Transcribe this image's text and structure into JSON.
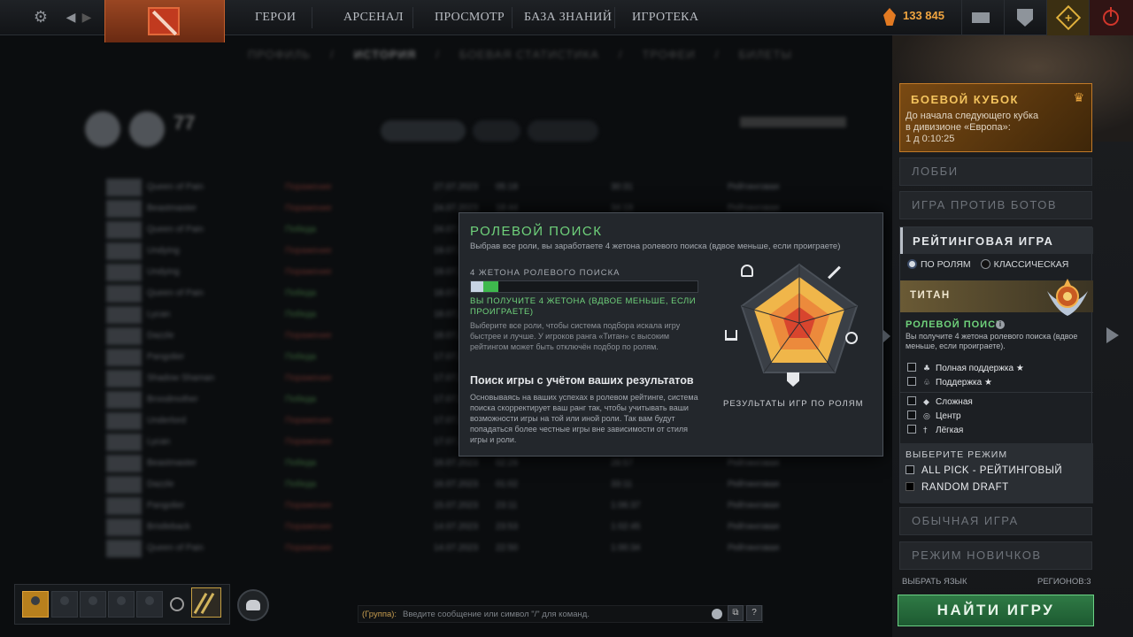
{
  "topbar": {
    "nav": [
      "ГЕРОИ",
      "АРСЕНАЛ",
      "ПРОСМОТР",
      "БАЗА ЗНАНИЙ",
      "ИГРОТЕКА"
    ],
    "shards": "133 845",
    "icons": [
      "gear-icon",
      "back-icon",
      "forward-icon",
      "dota-logo",
      "shard-icon",
      "mail-icon",
      "armory-icon",
      "plus-icon",
      "power-icon"
    ]
  },
  "history": {
    "subtabs": [
      "ПРОФИЛЬ",
      "/",
      "ИСТОРИЯ",
      "/",
      "БОЕВАЯ СТАТИСТИКА",
      "/",
      "ТРОФЕИ",
      "/",
      "БИЛЕТЫ"
    ],
    "count": "77",
    "rows": [
      {
        "hero": "Queen of Pain",
        "res": "Поражение",
        "win": false,
        "date": "27.07.2023",
        "t": "05:18",
        "d": "30:31",
        "ty": "Рейтинговая"
      },
      {
        "hero": "Beastmaster",
        "res": "Поражение",
        "win": false,
        "date": "24.07.2023",
        "t": "18:44",
        "d": "34:19",
        "ty": "Рейтинговая"
      },
      {
        "hero": "Queen of Pain",
        "res": "Победа",
        "win": true,
        "date": "24.07.2023",
        "t": "17:12",
        "d": "41:02",
        "ty": "Рейтинговая"
      },
      {
        "hero": "Undying",
        "res": "Поражение",
        "win": false,
        "date": "19.07.2023",
        "t": "22:10",
        "d": "29:44",
        "ty": "Рейтинговая"
      },
      {
        "hero": "Undying",
        "res": "Поражение",
        "win": false,
        "date": "19.07.2023",
        "t": "20:58",
        "d": "38:12",
        "ty": "Рейтинговая"
      },
      {
        "hero": "Queen of Pain",
        "res": "Победа",
        "win": true,
        "date": "18.07.2023",
        "t": "21:33",
        "d": "33:50",
        "ty": "Рейтинговая"
      },
      {
        "hero": "Lycan",
        "res": "Победа",
        "win": true,
        "date": "18.07.2023",
        "t": "19:21",
        "d": "27:18",
        "ty": "Рейтинговая"
      },
      {
        "hero": "Dazzle",
        "res": "Поражение",
        "win": false,
        "date": "18.07.2023",
        "t": "18:04",
        "d": "44:27",
        "ty": "Рейтинговая"
      },
      {
        "hero": "Pangolier",
        "res": "Победа",
        "win": true,
        "date": "17.07.2023",
        "t": "23:41",
        "d": "36:05",
        "ty": "Рейтинговая"
      },
      {
        "hero": "Shadow Shaman",
        "res": "Поражение",
        "win": false,
        "date": "17.07.2023",
        "t": "22:02",
        "d": "31:47",
        "ty": "Рейтинговая"
      },
      {
        "hero": "Broodmother",
        "res": "Победа",
        "win": true,
        "date": "17.07.2023",
        "t": "20:30",
        "d": "29:13",
        "ty": "Рейтинговая"
      },
      {
        "hero": "Underlord",
        "res": "Поражение",
        "win": false,
        "date": "17.07.2023",
        "t": "19:15",
        "d": "40:38",
        "ty": "Рейтинговая"
      },
      {
        "hero": "Lycan",
        "res": "Поражение",
        "win": false,
        "date": "17.07.2023",
        "t": "17:49",
        "d": "35:26",
        "ty": "Рейтинговая"
      },
      {
        "hero": "Beastmaster",
        "res": "Победа",
        "win": true,
        "date": "16.07.2023",
        "t": "02:29",
        "d": "28:57",
        "ty": "Рейтинговая"
      },
      {
        "hero": "Dazzle",
        "res": "Победа",
        "win": true,
        "date": "16.07.2023",
        "t": "01:02",
        "d": "33:11",
        "ty": "Рейтинговая"
      },
      {
        "hero": "Pangolier",
        "res": "Поражение",
        "win": false,
        "date": "15.07.2023",
        "t": "23:11",
        "d": "1:06:37",
        "ty": "Рейтинговая"
      },
      {
        "hero": "Bristleback",
        "res": "Поражение",
        "win": false,
        "date": "14.07.2023",
        "t": "23:53",
        "d": "1:02:45",
        "ty": "Рейтинговая"
      },
      {
        "hero": "Queen of Pain",
        "res": "Поражение",
        "win": false,
        "date": "14.07.2023",
        "t": "22:50",
        "d": "1:00:34",
        "ty": "Рейтинговая"
      }
    ]
  },
  "popup": {
    "title": "РОЛЕВОЙ ПОИСК",
    "subtitle": "Выбрав все роли, вы заработаете 4 жетона ролевого поиска (вдвое меньше, если проиграете)",
    "tokens_label": "4 ЖЕТОНА РОЛЕВОГО ПОИСКА",
    "tokens_progress": 0.12,
    "green": "ВЫ ПОЛУЧИТЕ 4 ЖЕТОНА (ВДВОЕ МЕНЬШЕ, ЕСЛИ ПРОИГРАЕТЕ)",
    "desc1": "Выберите все роли, чтобы система подбора искала игру быстрее и лучше. У игроков ранга «Титан» с высоким рейтингом может быть отключён подбор по ролям.",
    "h2": "Поиск игры с учётом ваших результатов",
    "desc2": "Основываясь на ваших успехах в ролевом рейтинге, система поиска скорректирует ваш ранг так, чтобы учитывать ваши возможности игры на той или иной роли. Так вам будут попадаться более честные игры вне зависимости от стиля игры и роли.",
    "radar_caption": "РЕЗУЛЬТАТЫ ИГР ПО РОЛЯМ",
    "radar_icons": [
      "support-icon",
      "sword-icon",
      "bow-icon",
      "shield-icon",
      "hand-icon"
    ]
  },
  "rpanel": {
    "cup": {
      "title": "БОЕВОЙ КУБОК",
      "line1": "До начала следующего кубка",
      "line2": "в дивизионе «Европа»:",
      "line3": "1 д 0:10:25"
    },
    "lobby": "ЛОББИ",
    "bots": "ИГРА ПРОТИВ БОТОВ",
    "ranked": "РЕЙТИНГОВАЯ ИГРА",
    "by_roles": "ПО РОЛЯМ",
    "classic": "КЛАССИЧЕСКАЯ",
    "rank": "ТИТАН",
    "rs_title": "РОЛЕВОЙ ПОИСК",
    "rs_text": "Вы получите 4 жетона ролевого поиска (вдвое меньше, если проиграете).",
    "roles": [
      "Полная поддержка",
      "Поддержка",
      "Сложная",
      "Центр",
      "Лёгкая"
    ],
    "star": "★",
    "select_mode": "ВЫБЕРИТЕ РЕЖИМ",
    "modes": [
      "ALL PICK - РЕЙТИНГОВЫЙ",
      "RANDOM DRAFT"
    ],
    "normal": "ОБЫЧНАЯ ИГРА",
    "newbie": "РЕЖИМ НОВИЧКОВ",
    "language": "ВЫБРАТЬ ЯЗЫК",
    "regions": "РЕГИОНОВ:3",
    "find": "НАЙТИ ИГРУ"
  },
  "bottom": {
    "chat_group": "(Группа):",
    "chat_placeholder": "Введите сообщение или символ \"/\" для команд.",
    "help": "?"
  }
}
